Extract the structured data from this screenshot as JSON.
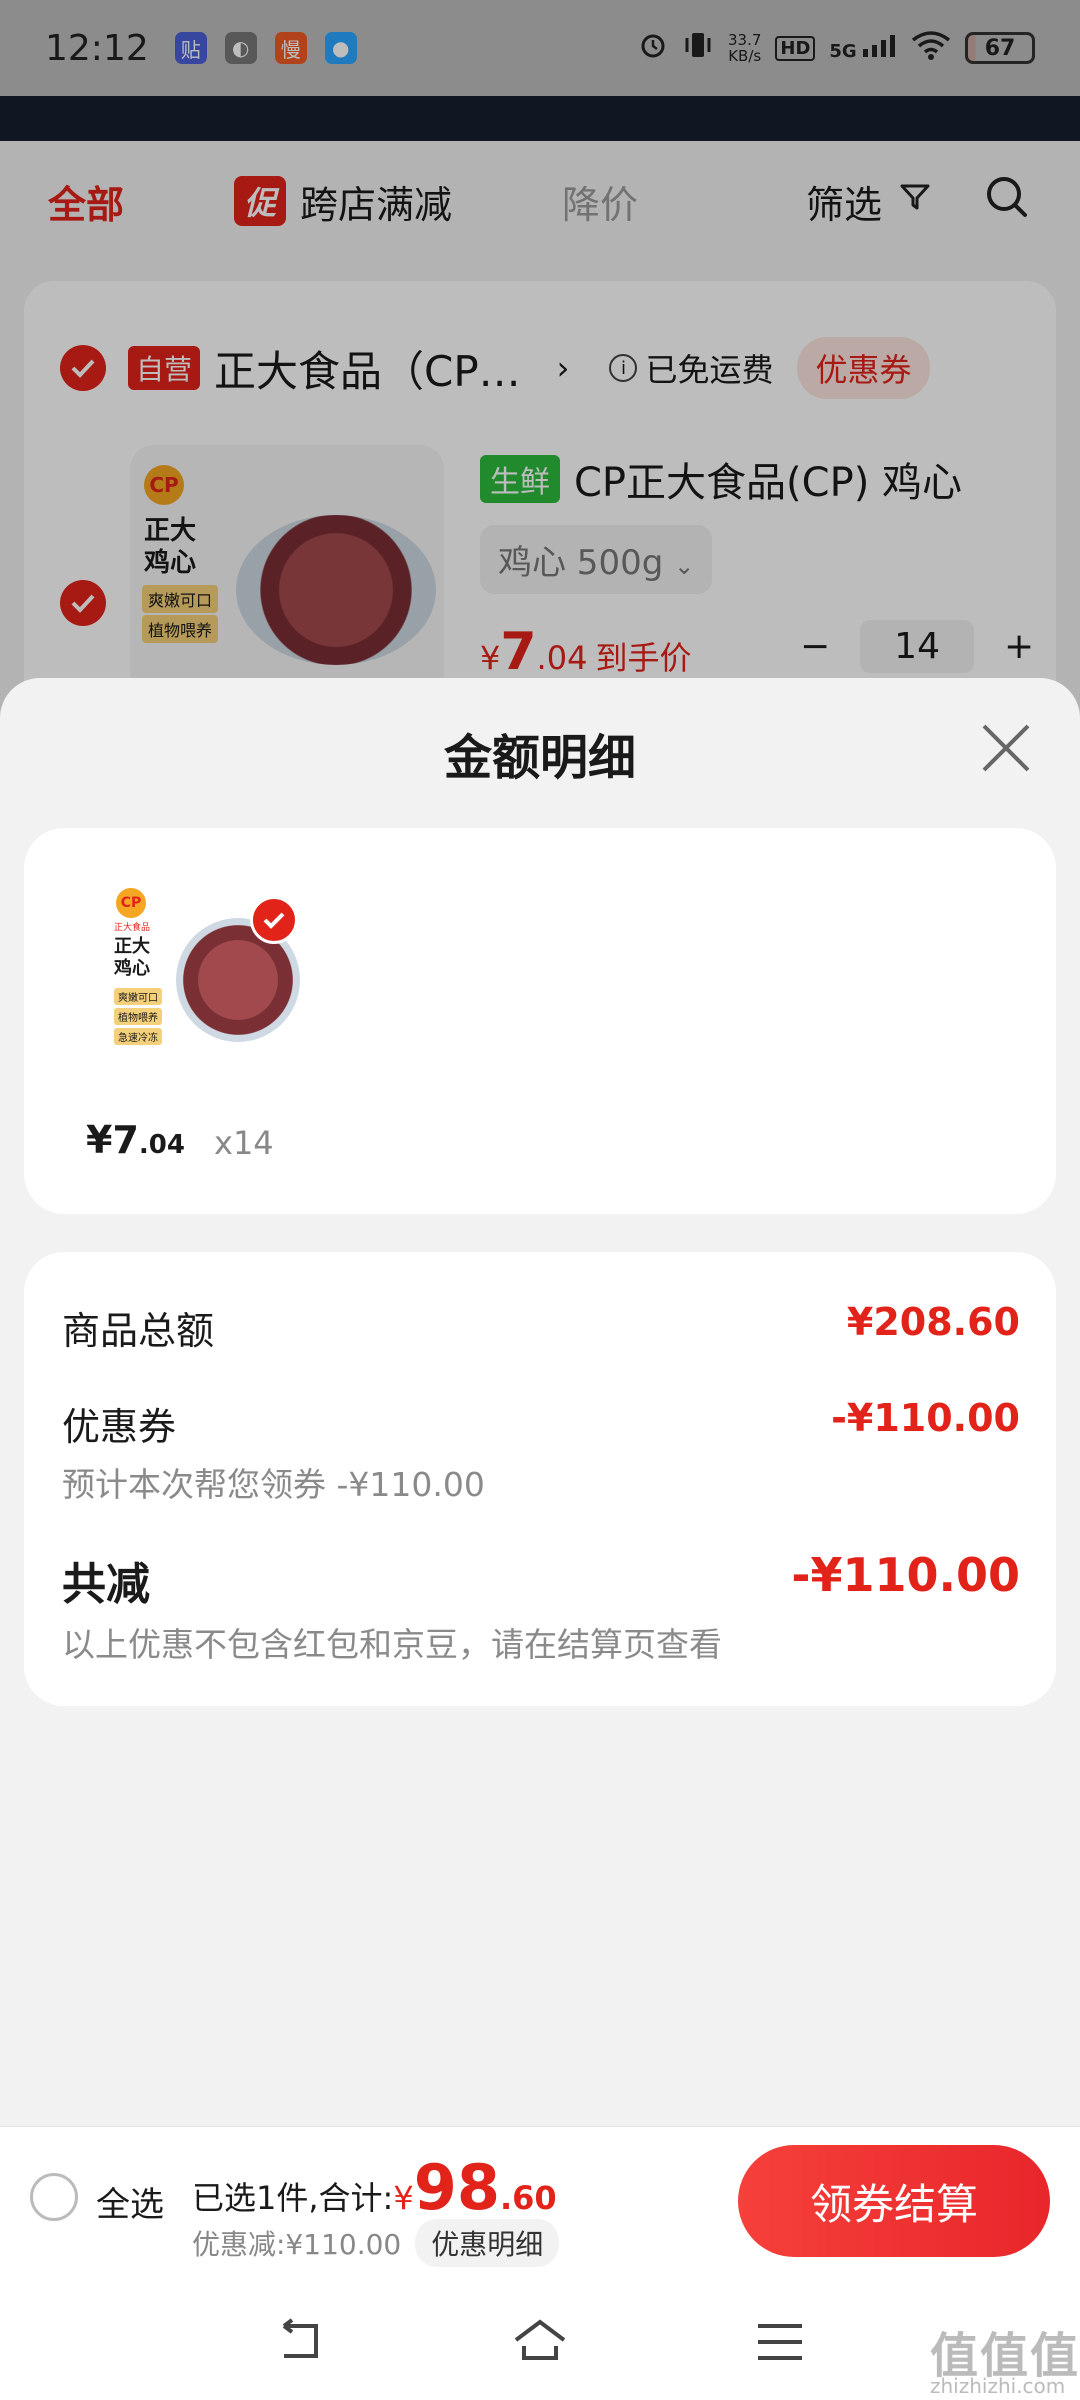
{
  "status_bar": {
    "time": "12:12",
    "net_speed_value": "33.7",
    "net_speed_unit": "KB/s",
    "hd": "HD",
    "network": "5G",
    "battery": "67",
    "app_badges": [
      "贴",
      "◐",
      "慢",
      "●"
    ]
  },
  "tabs": {
    "all": "全部",
    "promo_badge": "促",
    "promo": "跨店满减",
    "price_drop": "降价",
    "filter": "筛选"
  },
  "shop": {
    "self_badge": "自营",
    "name": "正大食品（CP…",
    "arrow": "›",
    "free_shipping": "已免运费",
    "coupon": "优惠券"
  },
  "product": {
    "fresh_badge": "生鲜",
    "title": "CP正大食品(CP) 鸡心",
    "variant": "鸡心 500g",
    "price_currency": "¥",
    "price_int": "7",
    "price_dec": ".04",
    "price_suffix": "到手价",
    "qty_minus": "−",
    "qty": "14",
    "qty_plus": "+",
    "package_brand": "CP",
    "package_line1": "正大",
    "package_line2": "鸡心",
    "package_tag1": "爽嫩可口",
    "package_tag2": "植物喂养"
  },
  "sheet": {
    "title": "金额明细",
    "item": {
      "price_int": "¥7",
      "price_dec": ".04",
      "qty": "x14",
      "package_brand": "CP",
      "package_maker": "正大食品",
      "package_line1": "正大",
      "package_line2": "鸡心",
      "package_tags": [
        "爽嫩可口",
        "植物喂养",
        "急速冷冻"
      ]
    },
    "summary": {
      "total_label": "商品总额",
      "total_value": "¥208.60",
      "coupon_label": "优惠券",
      "coupon_value": "-¥110.00",
      "coupon_sub": "预计本次帮您领券 -¥110.00",
      "reduce_label": "共减",
      "reduce_value": "-¥110.00",
      "reduce_sub": "以上优惠不包含红包和京豆，请在结算页查看"
    }
  },
  "bottom_bar": {
    "select_all": "全选",
    "selected_text": "已选1件,合计:",
    "total_currency": "¥",
    "total_int": "98",
    "total_dec": ".60",
    "discount_text": "优惠减:¥110.00",
    "detail_button": "优惠明细",
    "checkout": "领券结算"
  },
  "watermark": {
    "text": "值值值",
    "sub": "zhizhizhi.com"
  },
  "colors": {
    "accent": "#e2231a",
    "checkout_gradient_start": "#f6403a",
    "checkout_gradient_end": "#e8262b",
    "fresh_green": "#2dbb3c"
  }
}
